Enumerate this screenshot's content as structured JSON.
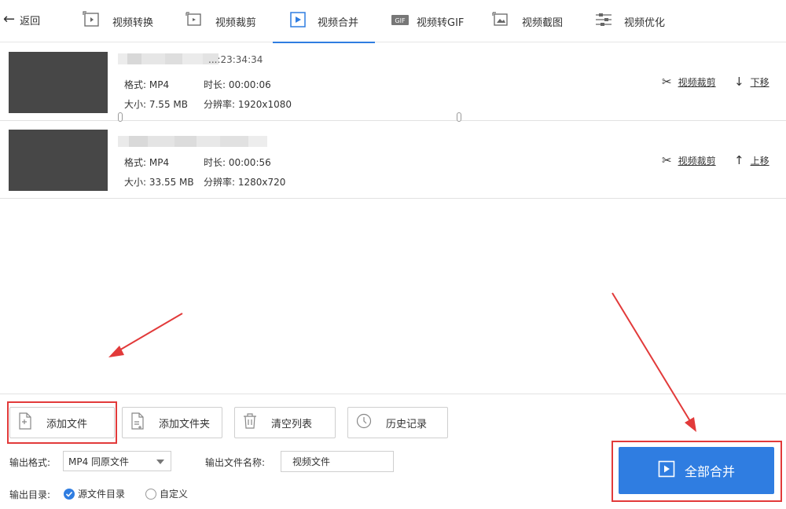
{
  "header": {
    "back_label": "返回",
    "tabs": [
      {
        "label": "视频转换",
        "icon": "video-convert-icon"
      },
      {
        "label": "视频裁剪",
        "icon": "video-crop-icon"
      },
      {
        "label": "视频合并",
        "icon": "video-merge-icon",
        "active": true
      },
      {
        "label": "视频转GIF",
        "icon": "gif-icon"
      },
      {
        "label": "视频截图",
        "icon": "screenshot-icon"
      },
      {
        "label": "视频优化",
        "icon": "optimize-icon"
      }
    ]
  },
  "files": [
    {
      "name_visible": "...:23:34:34",
      "format": "格式: MP4",
      "duration": "时长: 00:00:06",
      "size": "大小: 7.55 MB",
      "resolution": "分辨率: 1920x1080",
      "crop_label": "视频裁剪",
      "move_label": "下移"
    },
    {
      "format": "格式: MP4",
      "duration": "时长: 00:00:56",
      "size": "大小: 33.55 MB",
      "resolution": "分辨率: 1280x720",
      "crop_label": "视频裁剪",
      "move_label": "上移"
    }
  ],
  "toolbar": {
    "add_file": "添加文件",
    "add_folder": "添加文件夹",
    "clear_list": "清空列表",
    "history": "历史记录"
  },
  "output": {
    "format_label": "输出格式:",
    "format_value": "MP4 同原文件",
    "filename_label": "输出文件名称:",
    "filename_value": "视频文件",
    "dir_label": "输出目录:",
    "dir_source": "源文件目录",
    "dir_custom": "自定义",
    "dir_selected": "源文件目录"
  },
  "merge_button": "全部合并",
  "colors": {
    "accent": "#2f7de1",
    "annotation": "#e23a3a",
    "thumb": "#474747"
  }
}
